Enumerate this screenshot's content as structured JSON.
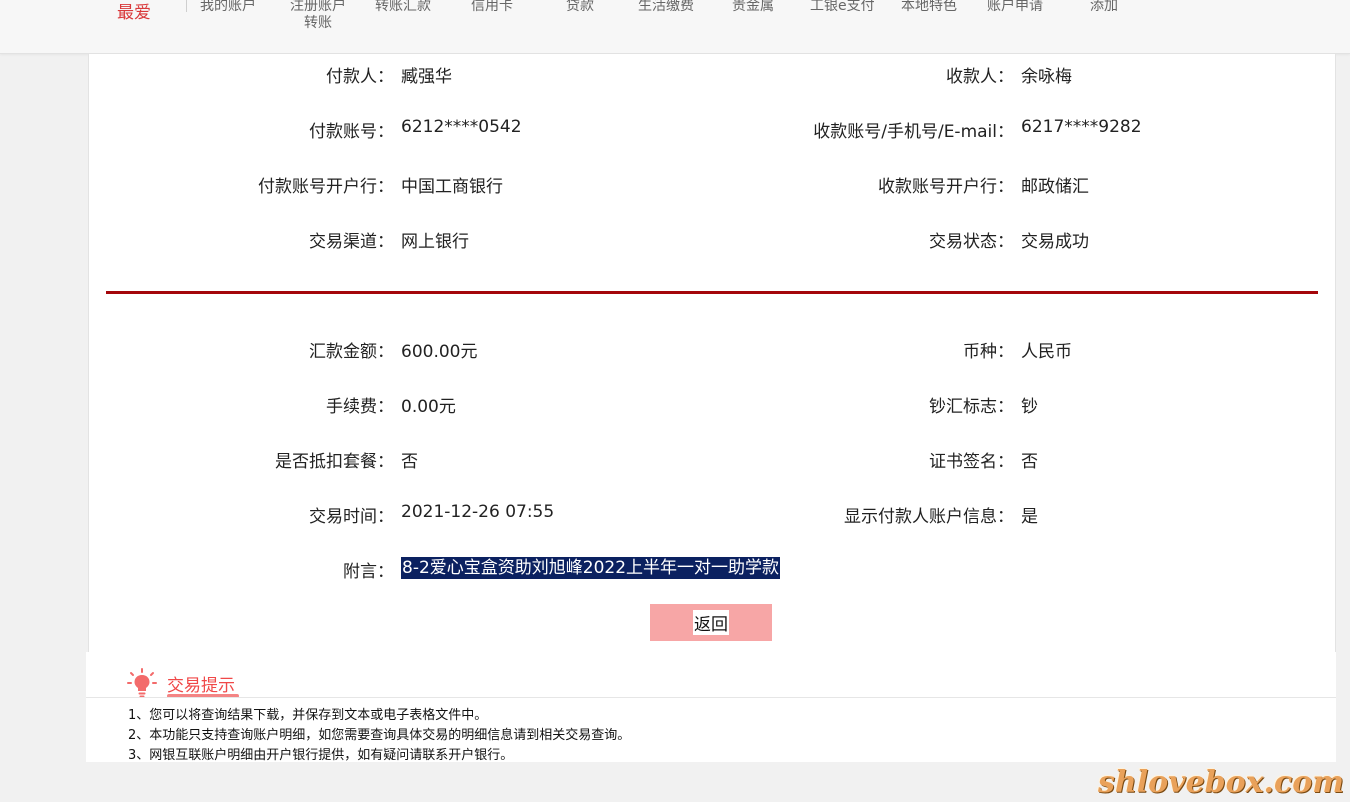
{
  "nav": {
    "items": [
      {
        "id": "fav",
        "label": "最爱"
      },
      {
        "id": "my-account",
        "label": "我的账户"
      },
      {
        "id": "registered-transfer",
        "label": "注册账户转账",
        "line1": "注册账户",
        "line2": "转账"
      },
      {
        "id": "transfer",
        "label": "转账汇款"
      },
      {
        "id": "credit-card",
        "label": "信用卡"
      },
      {
        "id": "loan",
        "label": "贷款"
      },
      {
        "id": "bills",
        "label": "生活缴费"
      },
      {
        "id": "precious-metal",
        "label": "贵金属"
      },
      {
        "id": "epay",
        "label": "工银e支付"
      },
      {
        "id": "local",
        "label": "本地特色"
      },
      {
        "id": "account-apply",
        "label": "账户申请"
      },
      {
        "id": "add",
        "label": "添加"
      }
    ]
  },
  "details": {
    "payer": {
      "label": "付款人：",
      "value": "臧强华"
    },
    "payee": {
      "label": "收款人：",
      "value": "余咏梅"
    },
    "payer_account": {
      "label": "付款账号：",
      "value": "6212****0542"
    },
    "payee_account": {
      "label": "收款账号/手机号/E-mail：",
      "value": "6217****9282"
    },
    "payer_bank": {
      "label": "付款账号开户行：",
      "value": "中国工商银行"
    },
    "payee_bank": {
      "label": "收款账号开户行：",
      "value": "邮政储汇"
    },
    "channel": {
      "label": "交易渠道：",
      "value": "网上银行"
    },
    "status": {
      "label": "交易状态：",
      "value": "交易成功"
    },
    "amount": {
      "label": "汇款金额：",
      "value": "600.00元"
    },
    "currency": {
      "label": "币种：",
      "value": "人民币"
    },
    "fee": {
      "label": "手续费：",
      "value": "0.00元"
    },
    "cash_flag": {
      "label": "钞汇标志：",
      "value": "钞"
    },
    "package": {
      "label": "是否抵扣套餐：",
      "value": "否"
    },
    "cert_sign": {
      "label": "证书签名：",
      "value": "否"
    },
    "time": {
      "label": "交易时间：",
      "value": "2021-12-26 07:55"
    },
    "show_payer": {
      "label": "显示付款人账户信息：",
      "value": "是"
    },
    "memo": {
      "label": "附言：",
      "value": "8-2爱心宝盒资助刘旭峰2022上半年一对一助学款"
    }
  },
  "actions": {
    "back_label": "返回"
  },
  "tips": {
    "title": "交易提示",
    "lines": [
      "1、您可以将查询结果下载，并保存到文本或电子表格文件中。",
      "2、本功能只支持查询账户明细，如您需要查询具体交易的明细信息请到相关交易查询。",
      "3、网银互联账户明细由开户银行提供，如有疑问请联系开户银行。"
    ]
  },
  "watermark": "shlovebox.com",
  "colors": {
    "accent_red": "#a4060a",
    "button_pink": "#f7a6a6",
    "memo_highlight": "#0b2160",
    "tips_red": "#f04848"
  }
}
